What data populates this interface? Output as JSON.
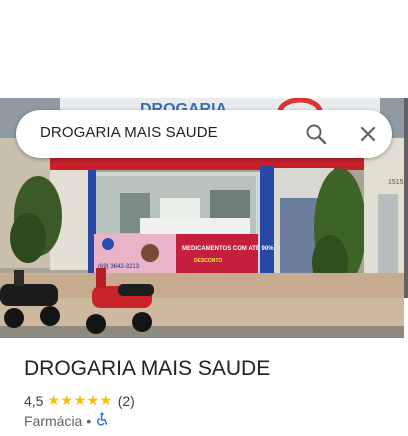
{
  "search": {
    "query": "DROGARIA MAIS SAUDE"
  },
  "photo": {
    "sign_text": "DROGARIA",
    "banner_text": "MEDICAMENTOS COM ATÉ 90%",
    "banner_sub": "DESCONTO",
    "phone": "(69) 3642-3213",
    "house_number": "1515"
  },
  "place": {
    "name": "DROGARIA MAIS SAUDE",
    "rating": "4,5",
    "stars": "★★★★★",
    "review_count": "(2)",
    "category": "Farmácia",
    "separator": "•"
  },
  "colors": {
    "star": "#fbbc04",
    "accessibility": "#1a73e8"
  }
}
